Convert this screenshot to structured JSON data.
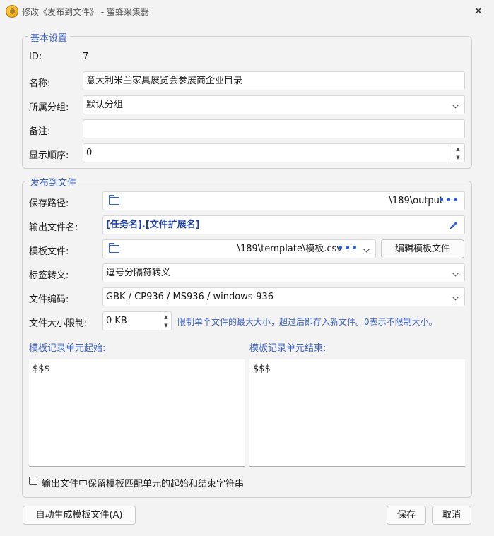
{
  "window": {
    "title": "修改《发布到文件》 - 蜜蜂采集器",
    "close_glyph": "✕"
  },
  "basic": {
    "legend": "基本设置",
    "id_label": "ID:",
    "id_value": "7",
    "name_label": "名称:",
    "name_value": "意大利米兰家具展览会参展商企业目录",
    "group_label": "所属分组:",
    "group_value": "默认分组",
    "note_label": "备注:",
    "note_value": "",
    "order_label": "显示顺序:",
    "order_value": "0"
  },
  "publish": {
    "legend": "发布到文件",
    "save_path_label": "保存路径:",
    "save_path_value": "\\189\\output",
    "output_name_label": "输出文件名:",
    "output_name_value": "[任务名].[文件扩展名]",
    "template_label": "模板文件:",
    "template_value": "\\189\\template\\模板.csv",
    "edit_template_button": "编辑模板文件",
    "tag_escape_label": "标签转义:",
    "tag_escape_value": "逗号分隔符转义",
    "encoding_label": "文件编码:",
    "encoding_value": "GBK / CP936 / MS936 / windows-936",
    "size_limit_label": "文件大小限制:",
    "size_limit_value": "0 KB",
    "size_limit_hint": "限制单个文件的最大大小，超过后即存入新文件。0表示不限制大小。",
    "record_start_label": "模板记录单元起始:",
    "record_start_value": "$$$",
    "record_end_label": "模板记录单元结束:",
    "record_end_value": "$$$",
    "keep_markers_label": "输出文件中保留模板匹配单元的起始和结束字符串",
    "keep_markers_checked": false,
    "more_glyph": "•••"
  },
  "footer": {
    "auto_generate_button": "自动生成模板文件(A)",
    "save_button": "保存",
    "cancel_button": "取消"
  },
  "colors": {
    "accent": "#3f63c4",
    "icon_blue": "#2d5fd8",
    "background": "#f3f3f3"
  }
}
